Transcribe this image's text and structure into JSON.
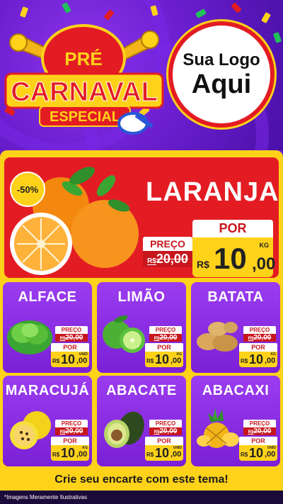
{
  "header": {
    "pre": "PRÉ",
    "carnaval": "CARNAVAL",
    "especial": "ESPECIAL",
    "logo_line1": "Sua Logo",
    "logo_line2": "Aqui"
  },
  "featured": {
    "name": "LARANJA",
    "discount": "-50%",
    "price_label": "PREÇO",
    "old_currency": "R$",
    "old_price": "20,00",
    "por_label": "POR",
    "currency": "R$",
    "price_int": "10",
    "price_dec": ",00",
    "unit": "KG"
  },
  "products": [
    {
      "name": "ALFACE",
      "price_label": "PREÇO",
      "old_currency": "R$",
      "old_price": "20,00",
      "por_label": "POR",
      "currency": "R$",
      "price_int": "10",
      "price_dec": ",00",
      "unit": "UNID"
    },
    {
      "name": "LIMÃO",
      "price_label": "PREÇO",
      "old_currency": "R$",
      "old_price": "20,00",
      "por_label": "POR",
      "currency": "R$",
      "price_int": "10",
      "price_dec": ",00",
      "unit": "KG"
    },
    {
      "name": "BATATA",
      "price_label": "PREÇO",
      "old_currency": "R$",
      "old_price": "20,00",
      "por_label": "POR",
      "currency": "R$",
      "price_int": "10",
      "price_dec": ",00",
      "unit": "KG"
    },
    {
      "name": "MARACUJÁ",
      "price_label": "PREÇO",
      "old_currency": "R$",
      "old_price": "20,00",
      "por_label": "POR",
      "currency": "R$",
      "price_int": "10",
      "price_dec": ",00",
      "unit": "KG"
    },
    {
      "name": "ABACATE",
      "price_label": "PREÇO",
      "old_currency": "R$",
      "old_price": "20,00",
      "por_label": "POR",
      "currency": "R$",
      "price_int": "10",
      "price_dec": ",00",
      "unit": "UNID"
    },
    {
      "name": "ABACAXI",
      "price_label": "PREÇO",
      "old_currency": "R$",
      "old_price": "20,00",
      "por_label": "POR",
      "currency": "R$",
      "price_int": "10",
      "price_dec": ",00",
      "unit": "UNID"
    }
  ],
  "cta": "Crie seu encarte com este tema!",
  "disclaimer": "*Imagens Meramente Ilustrativas",
  "colors": {
    "purple": "#6a1fc4",
    "red": "#e31c23",
    "yellow": "#ffd21a"
  }
}
